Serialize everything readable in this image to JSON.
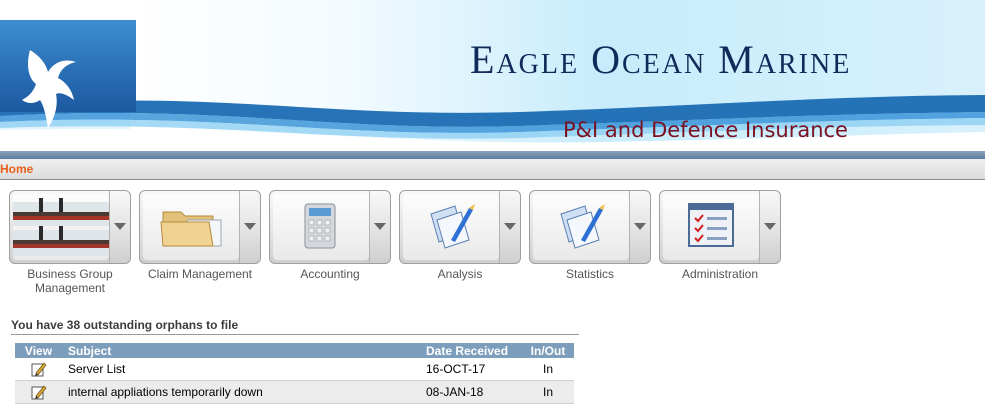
{
  "header": {
    "title": "Eagle Ocean Marine",
    "subtitle": "P&I and Defence Insurance",
    "colors": {
      "title": "#102a5a",
      "subtitle": "#7a1020",
      "banner_blue": "#2a6fb6"
    }
  },
  "breadcrumb": {
    "home": "Home"
  },
  "modules": [
    {
      "line1": "Business Group",
      "line2": "Management",
      "icon": "ship-icon"
    },
    {
      "line1": "Claim Management",
      "line2": "",
      "icon": "folder-icon"
    },
    {
      "line1": "Accounting",
      "line2": "",
      "icon": "calculator-icon"
    },
    {
      "line1": "Analysis",
      "line2": "",
      "icon": "documents-pen-icon"
    },
    {
      "line1": "Statistics",
      "line2": "",
      "icon": "documents-pen-icon"
    },
    {
      "line1": "Administration",
      "line2": "",
      "icon": "checklist-icon"
    }
  ],
  "orphans": {
    "message": "You have 38 outstanding orphans to file",
    "columns": [
      "View",
      "Subject",
      "Date Received",
      "In/Out"
    ],
    "rows": [
      {
        "subject": "Server List",
        "date": "16-OCT-17",
        "direction": "In"
      },
      {
        "subject": "internal appliations temporarily down",
        "date": "08-JAN-18",
        "direction": "In"
      }
    ]
  }
}
